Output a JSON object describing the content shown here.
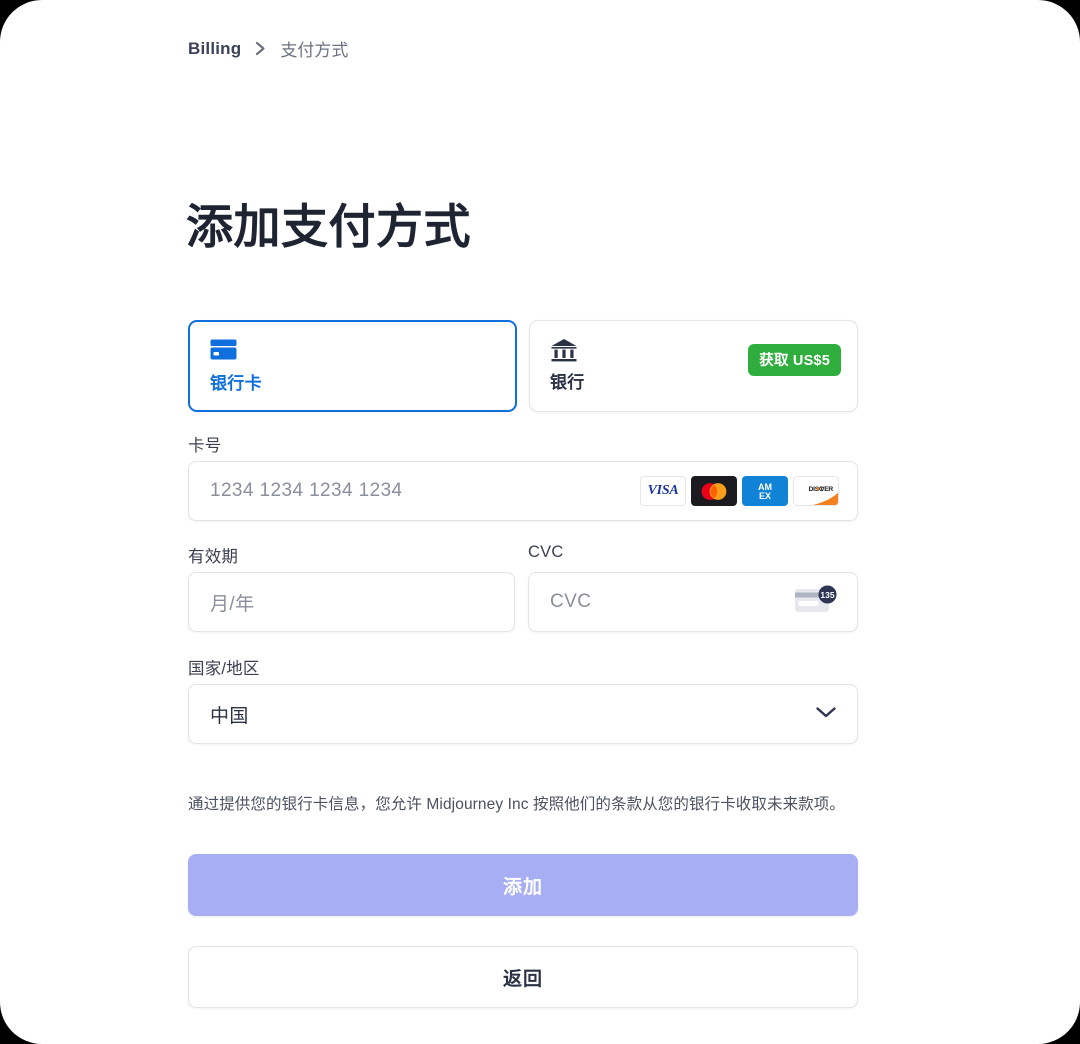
{
  "breadcrumb": {
    "root": "Billing",
    "separator": "›",
    "current": "支付方式"
  },
  "page_title": "添加支付方式",
  "payment_methods": [
    {
      "id": "card",
      "label": "银行卡",
      "icon": "credit-card-icon",
      "selected": true,
      "badge": null
    },
    {
      "id": "bank",
      "label": "银行",
      "icon": "bank-icon",
      "selected": false,
      "badge": "获取 US$5"
    }
  ],
  "form": {
    "card_number": {
      "label": "卡号",
      "value": "",
      "placeholder": "1234 1234 1234 1234",
      "brands": [
        "VISA",
        "Mastercard",
        "AMEX",
        "DISCOVER"
      ]
    },
    "expiry": {
      "label": "有效期",
      "value": "",
      "placeholder": "月/年"
    },
    "cvc": {
      "label": "CVC",
      "value": "",
      "placeholder": "CVC",
      "hint_icon_text": "135"
    },
    "country": {
      "label": "国家/地区",
      "value": "中国",
      "chevron": "chevron-down-icon"
    }
  },
  "disclaimer": "通过提供您的银行卡信息，您允许 Midjourney Inc 按照他们的条款从您的银行卡收取未来款项。",
  "buttons": {
    "primary": "添加",
    "secondary": "返回"
  },
  "colors": {
    "accent_blue": "#0f6fdd",
    "badge_green": "#2fad3d",
    "primary_button": "#a7aef4",
    "title_text": "#1f2433",
    "border": "#e3e3e9"
  },
  "brand_marks": {
    "visa": "VISA",
    "discover": "DISC●VER",
    "amex_line1": "AM",
    "amex_line2": "EX"
  }
}
